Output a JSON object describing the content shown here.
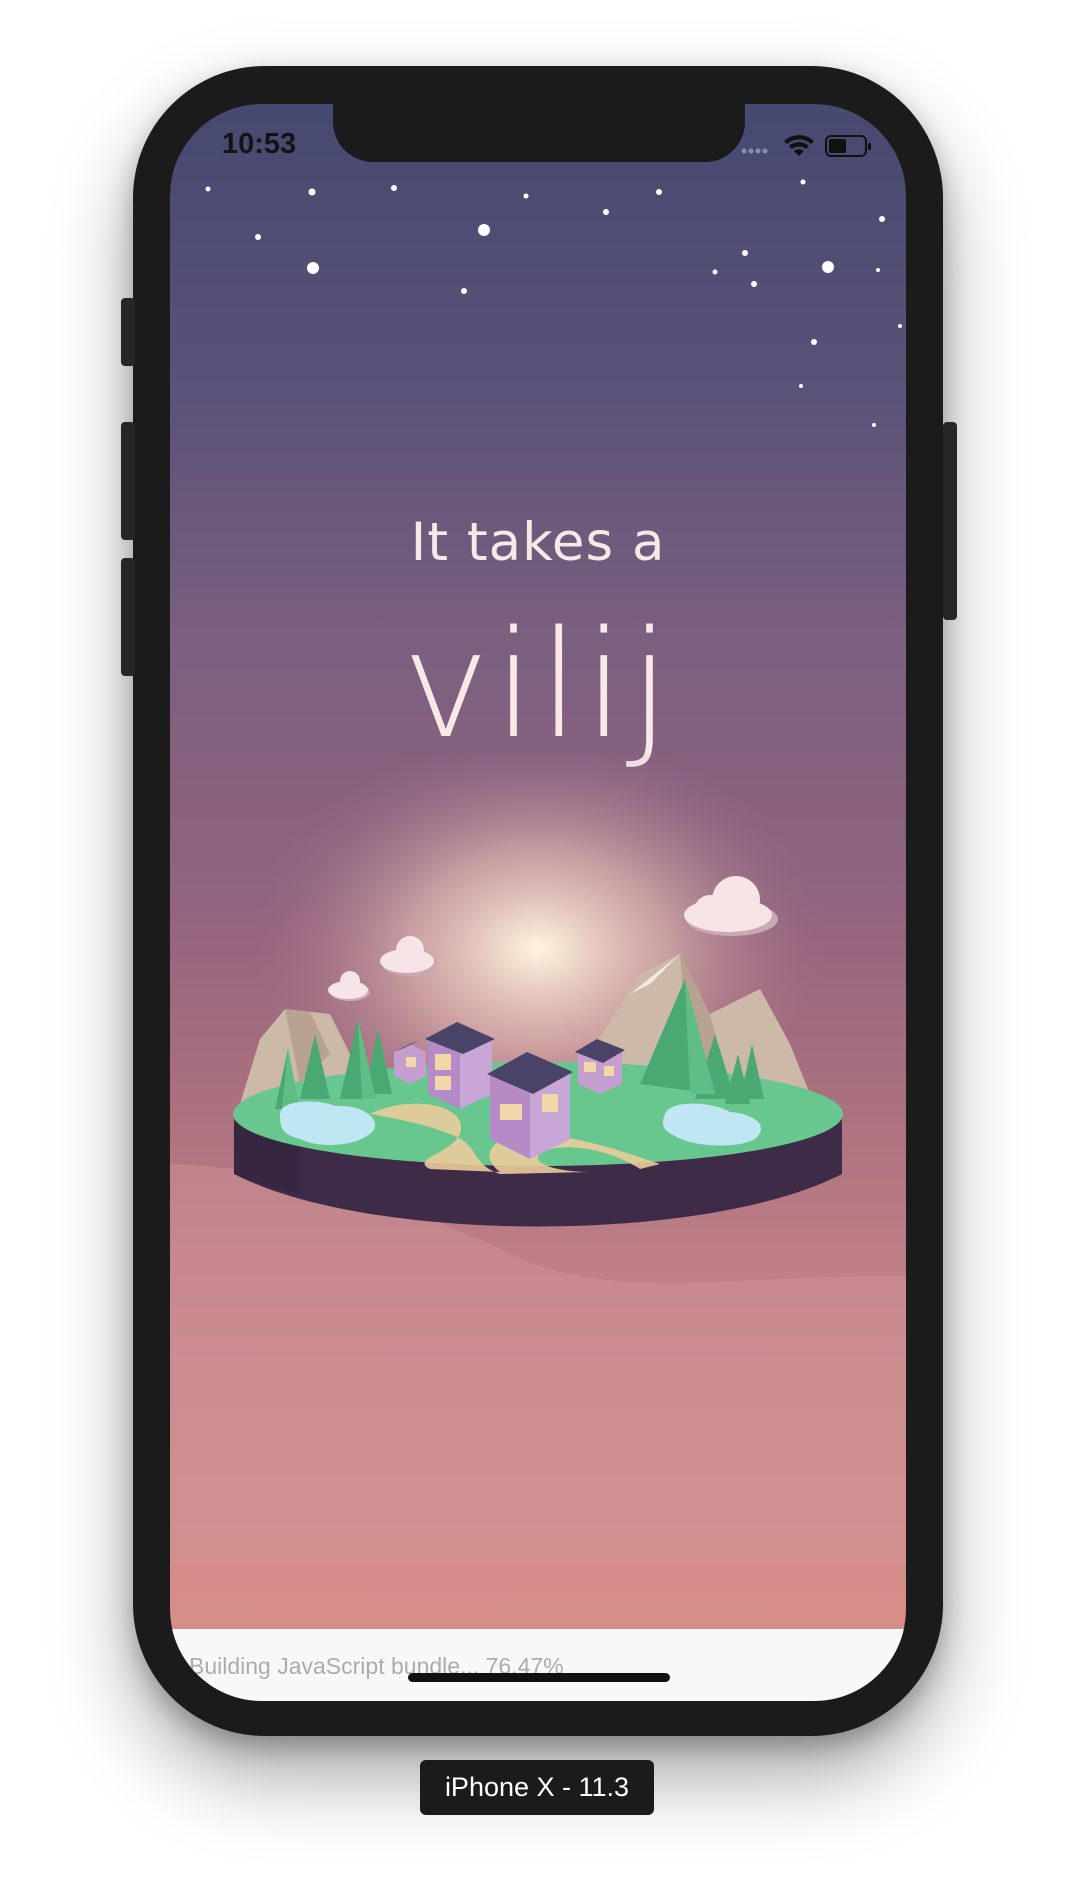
{
  "status_bar": {
    "time": "10:53",
    "icons": [
      "signal-dots-icon",
      "wifi-icon",
      "battery-icon"
    ]
  },
  "splash": {
    "tagline": "It takes a",
    "brand": "vilij"
  },
  "build_status": {
    "text": "Building JavaScript bundle... 76.47%",
    "progress_percent": 76.47
  },
  "device_label": "iPhone X - 11.3",
  "colors": {
    "sky_top": "#464970",
    "sky_bottom": "#db9087",
    "text": "#f8e8e8",
    "grass": "#68c68f",
    "island_base": "#3e2b48"
  }
}
